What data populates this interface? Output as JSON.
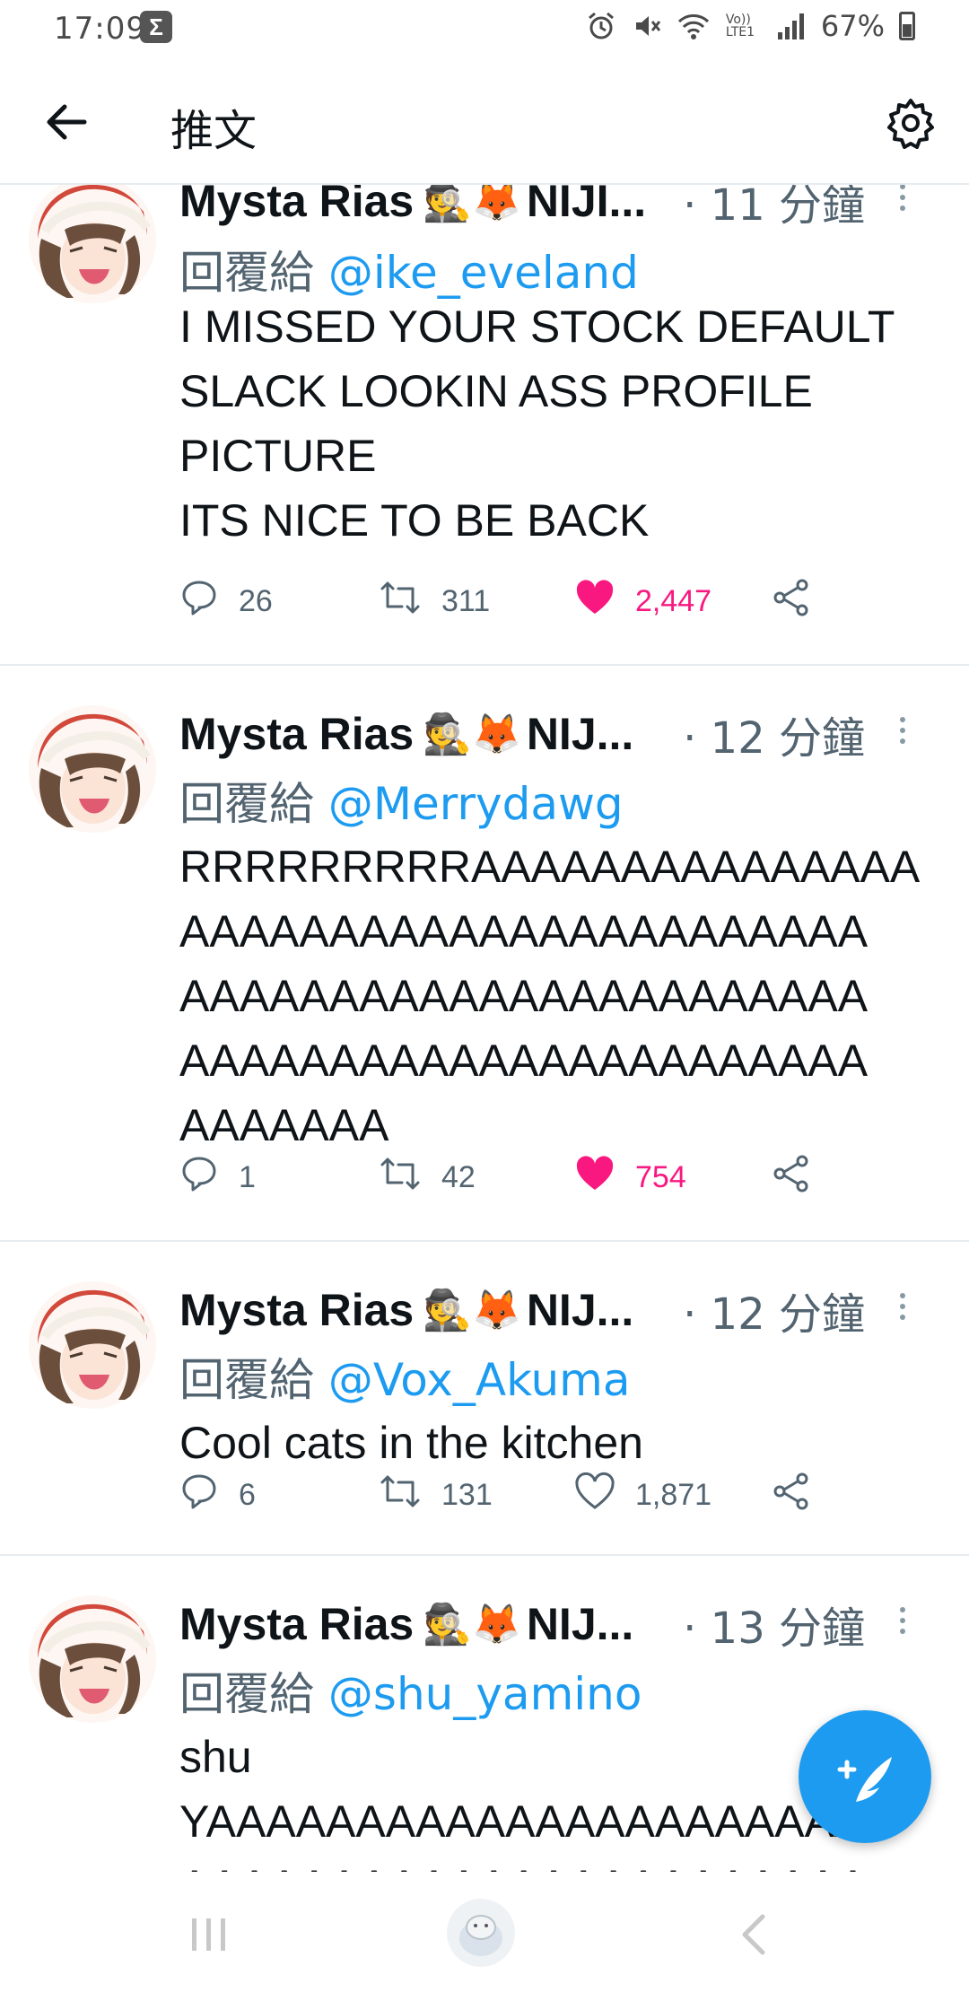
{
  "status_bar": {
    "time": "17:09",
    "app_icon": "sigma-icon",
    "volte": "Vo)) LTE1",
    "battery": "67%"
  },
  "header": {
    "title": "推文",
    "back_icon": "arrow-left-icon",
    "settings_icon": "gear-icon"
  },
  "colors": {
    "accent": "#1d9bf0",
    "like": "#f91880",
    "muted": "#536471",
    "text": "#0f1419"
  },
  "reply_prefix": "回覆給",
  "author": {
    "name": "Mysta Rias",
    "emoji": "🕵️🦊"
  },
  "tweets": [
    {
      "name_trunc": "NIJI...",
      "time": "· 11 分鐘",
      "reply_to": "@ike_eveland",
      "text": "I MISSED YOUR STOCK DEFAULT\nSLACK LOOKIN ASS PROFILE\nPICTURE\nITS NICE TO BE BACK",
      "replies": "26",
      "retweets": "311",
      "likes": "2,447",
      "liked": true
    },
    {
      "name_trunc": "NIJ...",
      "time": "· 12 分鐘",
      "reply_to": "@Merrydawg",
      "text": "RRRRRRRRRAAAAAAAAAAAAAAA\nAAAAAAAAAAAAAAAAAAAAAAA\nAAAAAAAAAAAAAAAAAAAAAAA\nAAAAAAAAAAAAAAAAAAAAAAA\nAAAAAAA",
      "replies": "1",
      "retweets": "42",
      "likes": "754",
      "liked": true
    },
    {
      "name_trunc": "NIJ...",
      "time": "· 12 分鐘",
      "reply_to": "@Vox_Akuma",
      "text": "Cool cats in the kitchen",
      "replies": "6",
      "retweets": "131",
      "likes": "1,871",
      "liked": false
    },
    {
      "name_trunc": "NIJ...",
      "time": "· 13 分鐘",
      "reply_to": "@shu_yamino",
      "text": "shu\nYAAAAAAAAAAAAAAAAAAAAAA\nAAAAAAAAAAAAAAAAAAAAAAA",
      "replies": "",
      "retweets": "",
      "likes": "",
      "liked": false
    }
  ],
  "fab": {
    "icon": "compose-tweet-icon",
    "symbol": "+"
  },
  "nav": {
    "recents_icon": "recent-apps-icon",
    "home_icon": "home-icon",
    "back_icon": "chevron-left-icon"
  }
}
